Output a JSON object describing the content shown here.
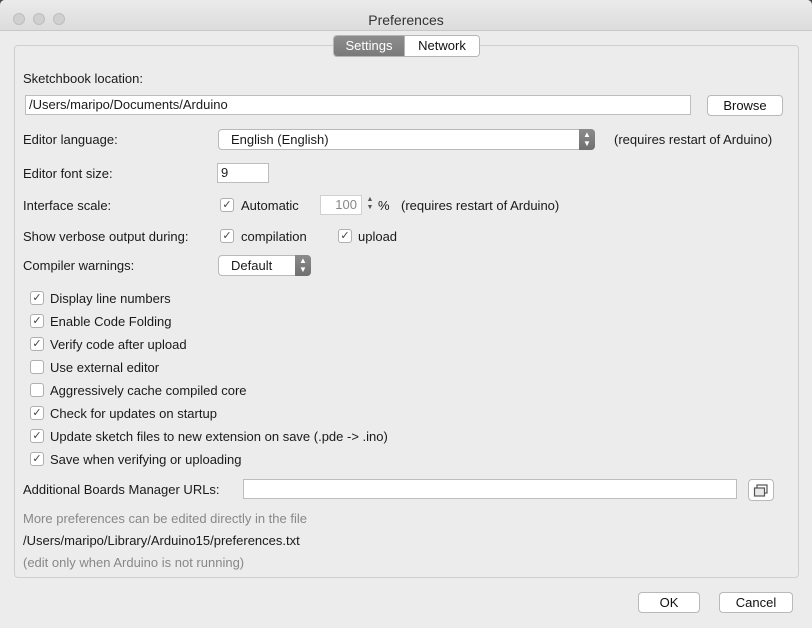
{
  "window": {
    "title": "Preferences"
  },
  "tabs": [
    {
      "label": "Settings",
      "active": true
    },
    {
      "label": "Network",
      "active": false
    }
  ],
  "sketchbook": {
    "label": "Sketchbook location:",
    "value": "/Users/maripo/Documents/Arduino",
    "browse_label": "Browse"
  },
  "editor_language": {
    "label": "Editor language:",
    "value": "English (English)",
    "note": "(requires restart of Arduino)"
  },
  "editor_font_size": {
    "label": "Editor font size:",
    "value": "9"
  },
  "interface_scale": {
    "label": "Interface scale:",
    "automatic_label": "Automatic",
    "automatic_checked": true,
    "value": "100",
    "unit": "%",
    "note": "(requires restart of Arduino)"
  },
  "verbose": {
    "label": "Show verbose output during:",
    "compilation_label": "compilation",
    "compilation_checked": true,
    "upload_label": "upload",
    "upload_checked": true
  },
  "compiler_warnings": {
    "label": "Compiler warnings:",
    "value": "Default"
  },
  "options": [
    {
      "label": "Display line numbers",
      "checked": true
    },
    {
      "label": "Enable Code Folding",
      "checked": true
    },
    {
      "label": "Verify code after upload",
      "checked": true
    },
    {
      "label": "Use external editor",
      "checked": false
    },
    {
      "label": "Aggressively cache compiled core",
      "checked": false
    },
    {
      "label": "Check for updates on startup",
      "checked": true
    },
    {
      "label": "Update sketch files to new extension on save (.pde -> .ino)",
      "checked": true
    },
    {
      "label": "Save when verifying or uploading",
      "checked": true
    }
  ],
  "boards_manager": {
    "label": "Additional Boards Manager URLs:",
    "value": ""
  },
  "footer_notes": {
    "more": "More preferences can be edited directly in the file",
    "path": "/Users/maripo/Library/Arduino15/preferences.txt",
    "edit_only": "(edit only when Arduino is not running)"
  },
  "actions": {
    "ok_label": "OK",
    "cancel_label": "Cancel"
  },
  "icons": {
    "check": "✓",
    "popup_arrows": "updown-icon",
    "window_icon": "open-window-icon"
  }
}
